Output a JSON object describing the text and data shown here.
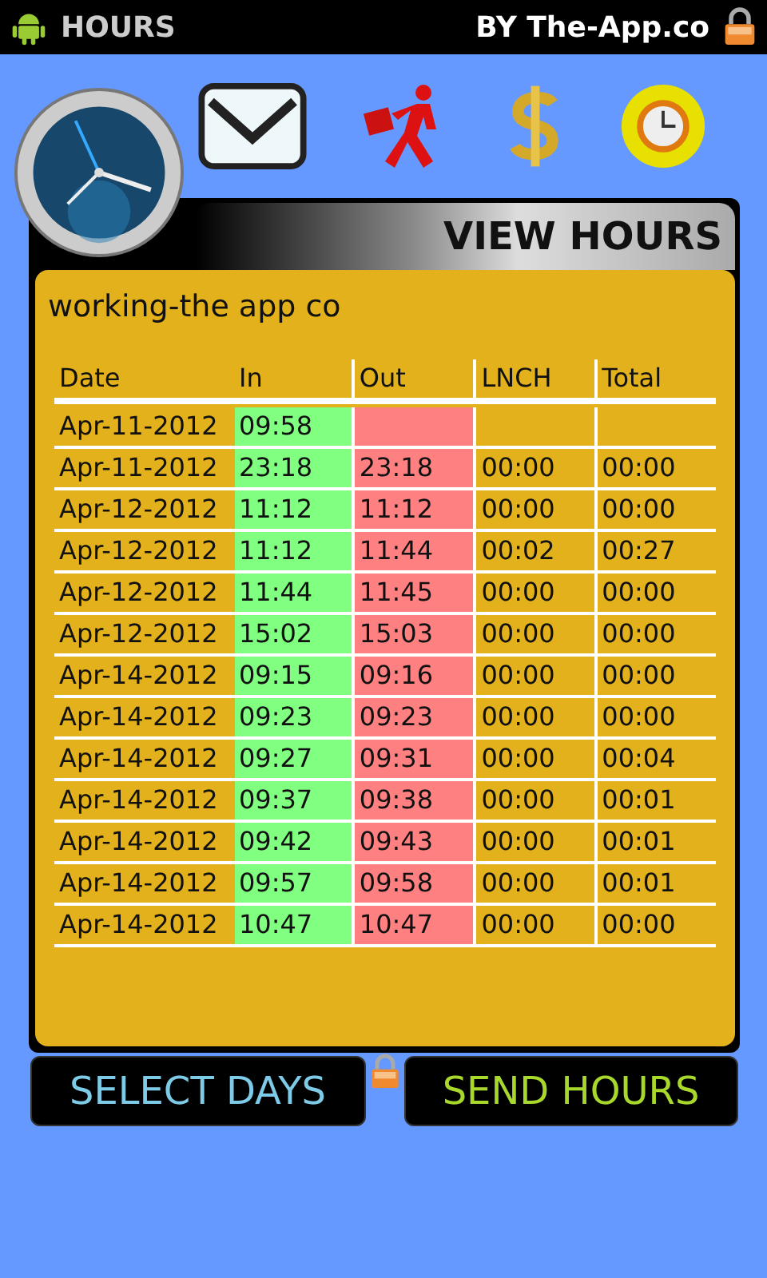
{
  "status_bar": {
    "title": "HOURS",
    "brand": "BY The-App.co"
  },
  "panel": {
    "title": "VIEW HOURS",
    "account": "working-the app co"
  },
  "table": {
    "columns": [
      "Date",
      "In",
      "Out",
      "LNCH",
      "Total"
    ],
    "rows": [
      {
        "date": "Apr-11-2012",
        "in": "09:58"
      },
      {
        "date": "Apr-11-2012",
        "in": "23:18",
        "out": "23:18",
        "lunch": "00:00",
        "total": "00:00"
      },
      {
        "date": "Apr-12-2012",
        "in": "11:12",
        "out": "11:12",
        "lunch": "00:00",
        "total": "00:00"
      },
      {
        "date": "Apr-12-2012",
        "in": "11:12",
        "out": "11:44",
        "lunch": "00:02",
        "total": "00:27"
      },
      {
        "date": "Apr-12-2012",
        "in": "11:44",
        "out": "11:45",
        "lunch": "00:00",
        "total": "00:00"
      },
      {
        "date": "Apr-12-2012",
        "in": "15:02",
        "out": "15:03",
        "lunch": "00:00",
        "total": "00:00"
      },
      {
        "date": "Apr-14-2012",
        "in": "09:15",
        "out": "09:16",
        "lunch": "00:00",
        "total": "00:00"
      },
      {
        "date": "Apr-14-2012",
        "in": "09:23",
        "out": "09:23",
        "lunch": "00:00",
        "total": "00:00"
      },
      {
        "date": "Apr-14-2012",
        "in": "09:27",
        "out": "09:31",
        "lunch": "00:00",
        "total": "00:04"
      },
      {
        "date": "Apr-14-2012",
        "in": "09:37",
        "out": "09:38",
        "lunch": "00:00",
        "total": "00:01"
      },
      {
        "date": "Apr-14-2012",
        "in": "09:42",
        "out": "09:43",
        "lunch": "00:00",
        "total": "00:01"
      },
      {
        "date": "Apr-14-2012",
        "in": "09:57",
        "out": "09:58",
        "lunch": "00:00",
        "total": "00:01"
      },
      {
        "date": "Apr-14-2012",
        "in": "10:47",
        "out": "10:47",
        "lunch": "00:00",
        "total": "00:00"
      }
    ]
  },
  "buttons": [
    {
      "label": "SELECT DAYS"
    },
    {
      "label": "SEND HOURS"
    }
  ]
}
